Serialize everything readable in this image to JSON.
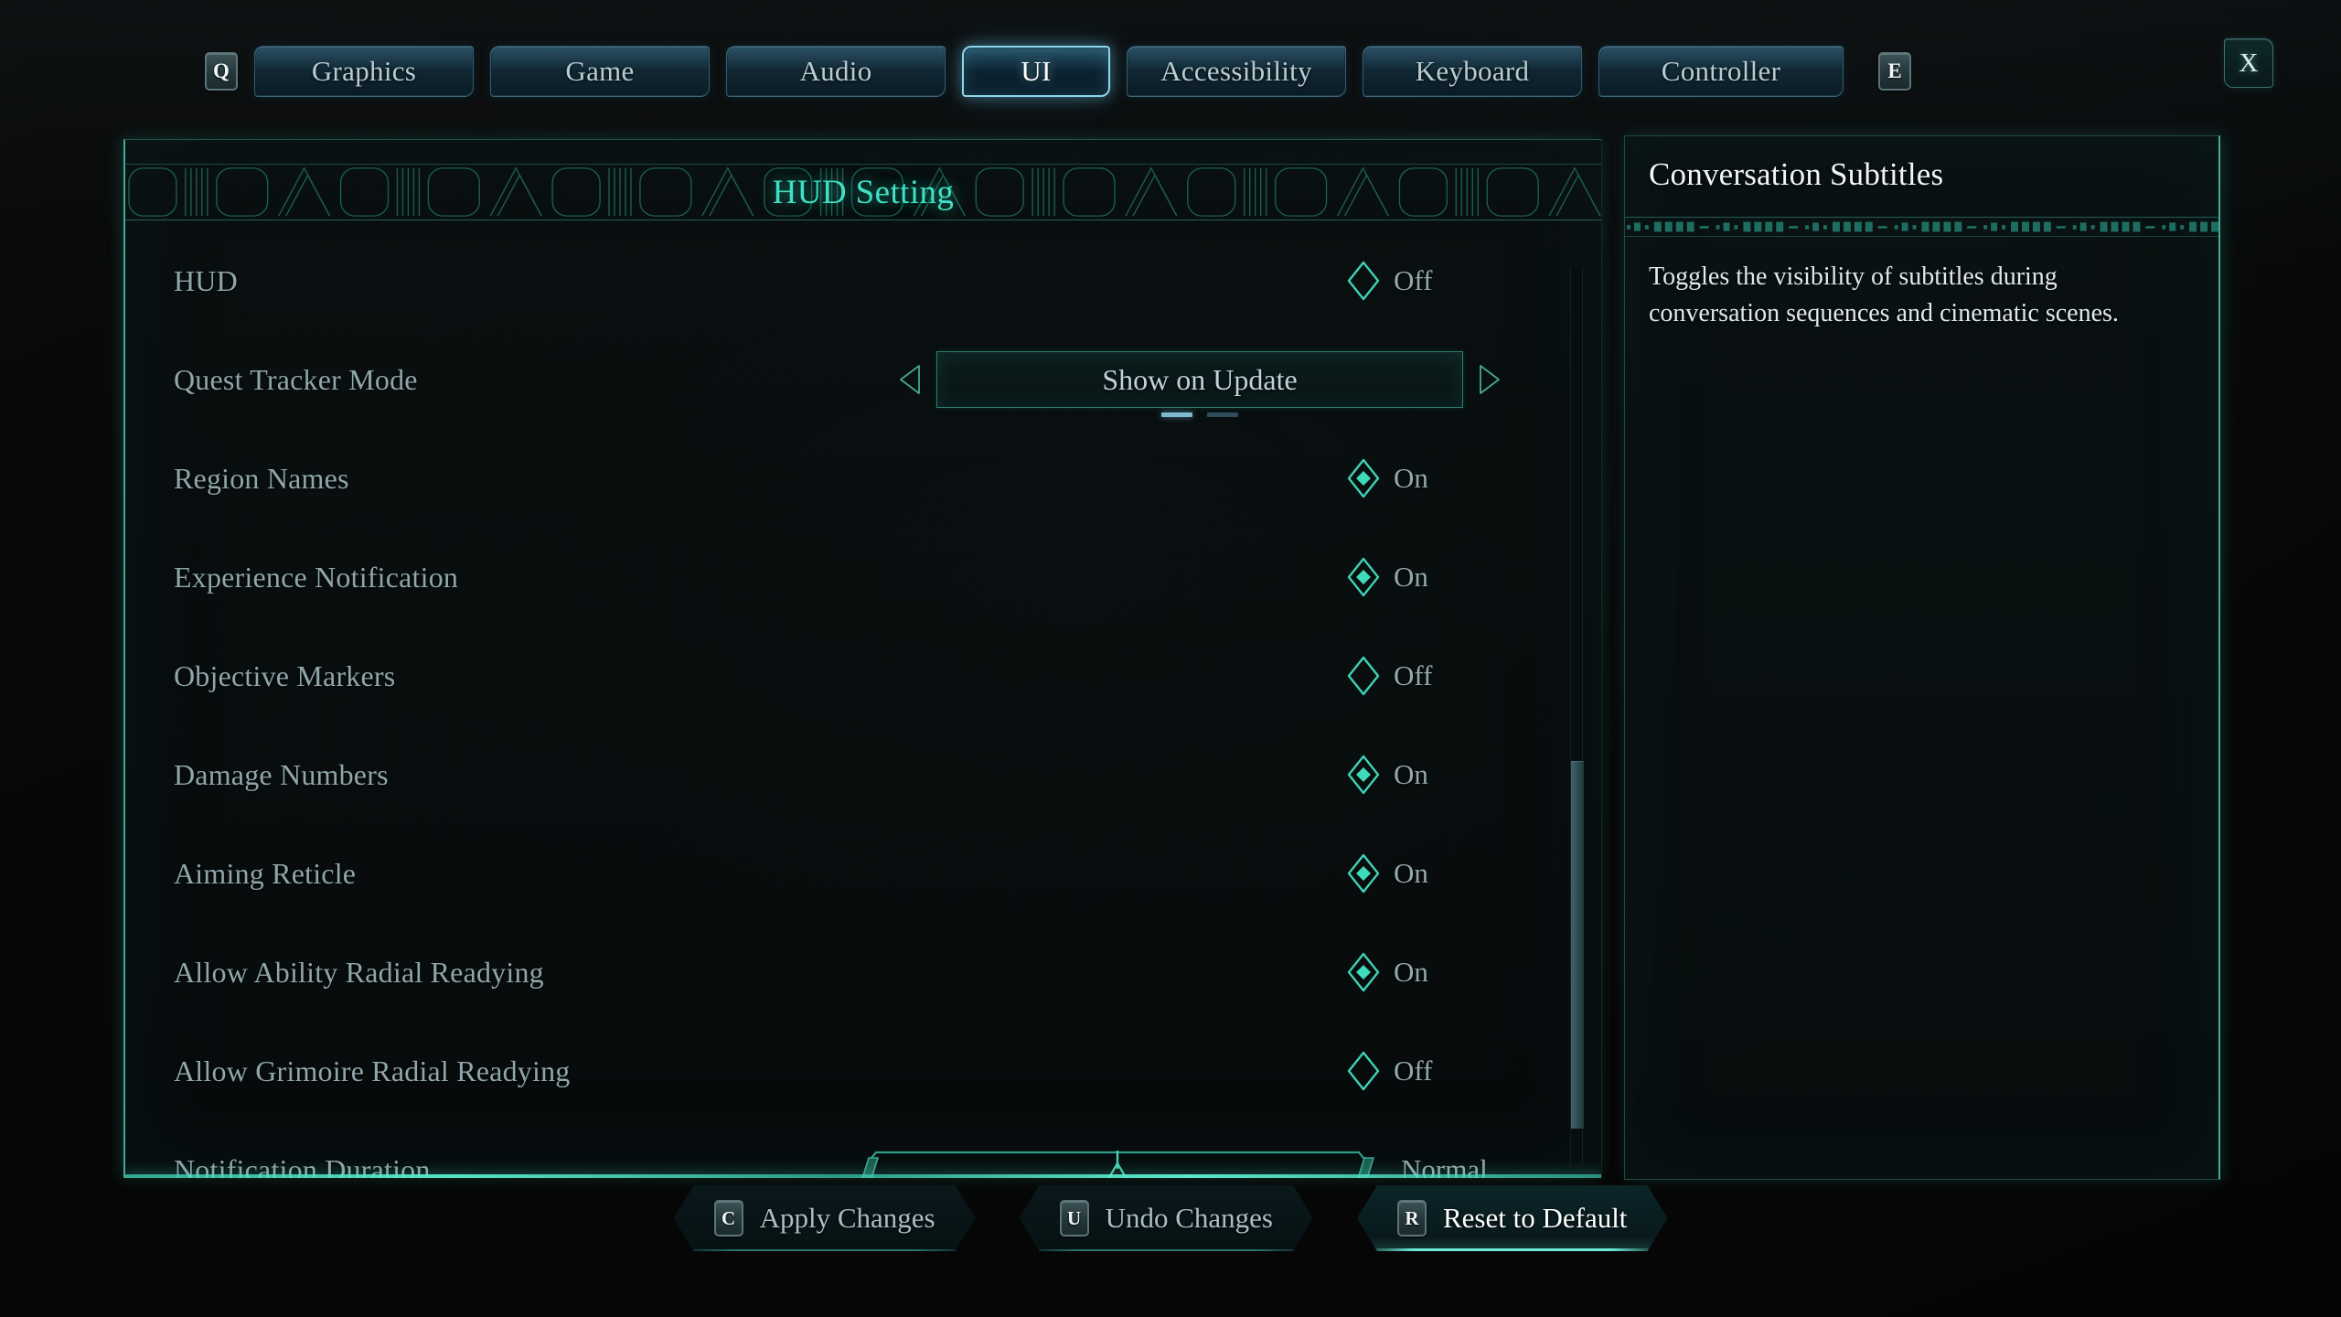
{
  "theme": {
    "accent_cyan": "#3fe0c4",
    "tab_active_border": "#8fd6ea",
    "label_color": "#8fa6ab",
    "panel_bg": "#0a1011",
    "background": "#070707"
  },
  "tabbar": {
    "left_keycap": "Q",
    "right_keycap": "E",
    "close_label": "X",
    "tabs": [
      {
        "label": "Graphics",
        "active": false,
        "width": "normal"
      },
      {
        "label": "Game",
        "active": false,
        "width": "normal"
      },
      {
        "label": "Audio",
        "active": false,
        "width": "normal"
      },
      {
        "label": "UI",
        "active": true,
        "width": "short"
      },
      {
        "label": "Accessibility",
        "active": false,
        "width": "normal"
      },
      {
        "label": "Keyboard",
        "active": false,
        "width": "normal"
      },
      {
        "label": "Controller",
        "active": false,
        "width": "wide"
      }
    ]
  },
  "settings_panel": {
    "title": "HUD Setting",
    "rows": [
      {
        "label": "HUD",
        "type": "toggle",
        "value": "Off"
      },
      {
        "label": "Quest Tracker Mode",
        "type": "carousel",
        "value": "Show on Update",
        "page_count": 2,
        "page_index": 0,
        "left_arrow": "left-arrow-icon",
        "right_arrow": "right-arrow-icon"
      },
      {
        "label": "Region Names",
        "type": "toggle",
        "value": "On"
      },
      {
        "label": "Experience Notification",
        "type": "toggle",
        "value": "On"
      },
      {
        "label": "Objective Markers",
        "type": "toggle",
        "value": "Off"
      },
      {
        "label": "Damage Numbers",
        "type": "toggle",
        "value": "On"
      },
      {
        "label": "Aiming Reticle",
        "type": "toggle",
        "value": "On"
      },
      {
        "label": "Allow Ability Radial Readying",
        "type": "toggle",
        "value": "On"
      },
      {
        "label": "Allow Grimoire Radial Readying",
        "type": "toggle",
        "value": "Off"
      },
      {
        "label": "Notification Duration",
        "type": "slider",
        "value": "Normal",
        "fill_percent": 50
      }
    ],
    "scrollbar": {
      "thumb_top_percent": 55,
      "thumb_height_percent": 41
    }
  },
  "description_panel": {
    "title": "Conversation Subtitles",
    "body": "Toggles the visibility of subtitles during conversation sequences and cinematic scenes."
  },
  "footer": {
    "buttons": [
      {
        "key": "C",
        "label": "Apply Changes",
        "highlight": false
      },
      {
        "key": "U",
        "label": "Undo Changes",
        "highlight": false
      },
      {
        "key": "R",
        "label": "Reset to Default",
        "highlight": true
      }
    ]
  }
}
